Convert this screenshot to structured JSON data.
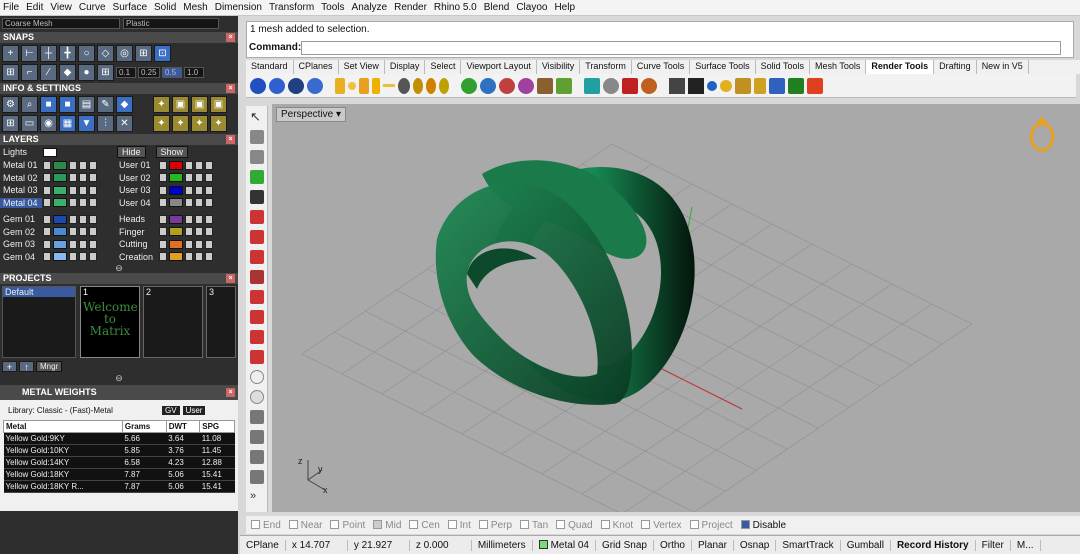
{
  "menu": [
    "File",
    "Edit",
    "View",
    "Curve",
    "Surface",
    "Solid",
    "Mesh",
    "Dimension",
    "Transform",
    "Tools",
    "Analyze",
    "Render",
    "Rhino 5.0",
    "Blend",
    "Clayoo",
    "Help"
  ],
  "left": {
    "mesh_select": "Coarse Mesh",
    "material_select": "Plastic",
    "snaps_title": "SNAPS",
    "snap_values": [
      "0.1",
      "0.25",
      "0.5",
      "1.0"
    ],
    "info_title": "INFO & SETTINGS",
    "layers_title": "LAYERS",
    "lights_label": "Lights",
    "hide_label": "Hide",
    "show_label": "Show",
    "layers_left": [
      "Metal 01",
      "Metal 02",
      "Metal 03",
      "Metal 04",
      "Gem 01",
      "Gem 02",
      "Gem 03",
      "Gem 04"
    ],
    "layers_right": [
      "User 01",
      "User 02",
      "User 03",
      "User 04",
      "Heads",
      "Finger",
      "Cutting",
      "Creation"
    ],
    "projects_title": "PROJECTS",
    "project_default": "Default",
    "project_slots": [
      "1",
      "2",
      "3"
    ],
    "welcome_text": "Welcome to Matrix",
    "mngr_label": "Mngr",
    "metal_title": "METAL WEIGHTS",
    "library_label": "Library: Classic - (Fast)-Metal",
    "gv_label": "GV",
    "user_label": "User",
    "metal_headers": [
      "Metal",
      "Grams",
      "DWT",
      "SPG"
    ],
    "metal_rows": [
      [
        "Yellow Gold:9KY",
        "5.66",
        "3.64",
        "11.08"
      ],
      [
        "Yellow Gold:10KY",
        "5.85",
        "3.76",
        "11.45"
      ],
      [
        "Yellow Gold:14KY",
        "6.58",
        "4.23",
        "12.88"
      ],
      [
        "Yellow Gold:18KY",
        "7.87",
        "5.06",
        "15.41"
      ],
      [
        "Yellow Gold:18KY R...",
        "7.87",
        "5.06",
        "15.41"
      ]
    ]
  },
  "command": {
    "history": "1 mesh added to selection.",
    "label": "Command:"
  },
  "tabs": [
    "Standard",
    "CPlanes",
    "Set View",
    "Display",
    "Select",
    "Viewport Layout",
    "Visibility",
    "Transform",
    "Curve Tools",
    "Surface Tools",
    "Solid Tools",
    "Mesh Tools",
    "Render Tools",
    "Drafting",
    "New in V5"
  ],
  "active_tab": "Render Tools",
  "viewport": {
    "label": "Perspective",
    "axis_y": "y",
    "axis_x": "x",
    "axis_z": "z"
  },
  "osnap": [
    "End",
    "Near",
    "Point",
    "Mid",
    "Cen",
    "Int",
    "Perp",
    "Tan",
    "Quad",
    "Knot",
    "Vertex",
    "Project",
    "Disable"
  ],
  "status": {
    "cplane": "CPlane",
    "x": "x 14.707",
    "y": "y 21.927",
    "z": "z 0.000",
    "units": "Millimeters",
    "layer": "Metal 04",
    "items": [
      "Grid Snap",
      "Ortho",
      "Planar",
      "Osnap",
      "SmartTrack",
      "Gumball",
      "Record History",
      "Filter",
      "M..."
    ]
  }
}
